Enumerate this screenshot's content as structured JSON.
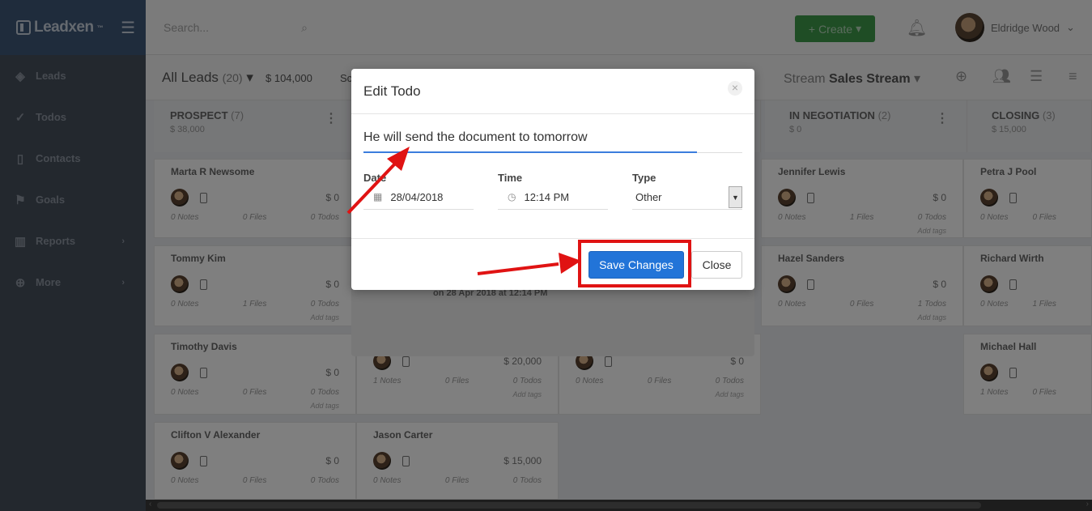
{
  "sidebar": {
    "logo": "Leadxen",
    "logo_tm": "™",
    "items": [
      {
        "label": "Leads",
        "icon": "layers-icon"
      },
      {
        "label": "Todos",
        "icon": "check-circle-icon"
      },
      {
        "label": "Contacts",
        "icon": "contact-book-icon"
      },
      {
        "label": "Goals",
        "icon": "flag-icon"
      },
      {
        "label": "Reports",
        "icon": "bar-chart-icon"
      },
      {
        "label": "More",
        "icon": "plus-circle-icon"
      }
    ]
  },
  "header": {
    "search_placeholder": "Search...",
    "create_label": "Create",
    "user_name": "Eldridge Wood"
  },
  "subheader": {
    "title": "All Leads",
    "count": "(20)",
    "total": "$ 104,000",
    "cut_text": "Sc",
    "stream_label": "Stream",
    "stream_name": "Sales Stream"
  },
  "columns": [
    {
      "title": "PROSPECT",
      "count": "(7)",
      "sum": "$ 38,000",
      "cards": [
        {
          "name": "Marta R Newsome",
          "amount": "$ 0",
          "notes": "0 Notes",
          "files": "0 Files",
          "todos": "0 Todos",
          "tags": ""
        },
        {
          "name": "Tommy Kim",
          "amount": "$ 0",
          "notes": "0 Notes",
          "files": "1 Files",
          "todos": "0 Todos",
          "tags": "Add tags"
        },
        {
          "name": "Timothy Davis",
          "amount": "$ 0",
          "notes": "0 Notes",
          "files": "0 Files",
          "todos": "0 Todos",
          "tags": "Add tags"
        },
        {
          "name": "Clifton V Alexander",
          "amount": "$ 0",
          "notes": "0 Notes",
          "files": "0 Files",
          "todos": "0 Todos",
          "tags": ""
        }
      ]
    },
    {
      "title": "",
      "count": "",
      "sum": "",
      "cards": [
        {
          "name": "",
          "amount": "$ 20,000",
          "notes": "1 Notes",
          "files": "0 Files",
          "todos": "0 Todos",
          "tags": "Add tags"
        },
        {
          "name": "Jason Carter",
          "amount": "$ 15,000",
          "notes": "0 Notes",
          "files": "0 Files",
          "todos": "0 Todos",
          "tags": ""
        }
      ]
    },
    {
      "title": "",
      "count": "",
      "sum": "",
      "cards": [
        {
          "name": "",
          "amount": "$ 0",
          "notes": "0 Notes",
          "files": "0 Files",
          "todos": "0 Todos",
          "tags": "Add tags"
        }
      ]
    },
    {
      "title": "IN NEGOTIATION",
      "count": "(2)",
      "sum": "$ 0",
      "cards": [
        {
          "name": "Jennifer Lewis",
          "amount": "$ 0",
          "notes": "0 Notes",
          "files": "1 Files",
          "todos": "0 Todos",
          "tags": "Add tags"
        },
        {
          "name": "Hazel Sanders",
          "amount": "$ 0",
          "notes": "0 Notes",
          "files": "0 Files",
          "todos": "1 Todos",
          "tags": "Add tags"
        }
      ]
    },
    {
      "title": "CLOSING",
      "count": "(3)",
      "sum": "$ 15,000",
      "cards": [
        {
          "name": "Petra J Pool",
          "amount": "",
          "notes": "0 Notes",
          "files": "0 Files",
          "todos": "",
          "tags": ""
        },
        {
          "name": "Richard Wirth",
          "amount": "",
          "notes": "0 Notes",
          "files": "1 Files",
          "todos": "",
          "tags": ""
        },
        {
          "name": "Michael Hall",
          "amount": "",
          "notes": "1 Notes",
          "files": "0 Files",
          "todos": "",
          "tags": ""
        }
      ]
    }
  ],
  "under_modal_text": "on 28 Apr 2018 at 12:14 PM",
  "modal": {
    "title": "Edit Todo",
    "close_glyph": "×",
    "todo_text": "He will send the document to tomorrow",
    "date_label": "Date",
    "date_value": "28/04/2018",
    "time_label": "Time",
    "time_value": "12:14 PM",
    "type_label": "Type",
    "type_value": "Other",
    "save_label": "Save Changes",
    "close_label": "Close"
  },
  "colors": {
    "accent": "#2274d8",
    "annotation": "#e01313",
    "create_green": "#3f9b4b"
  }
}
